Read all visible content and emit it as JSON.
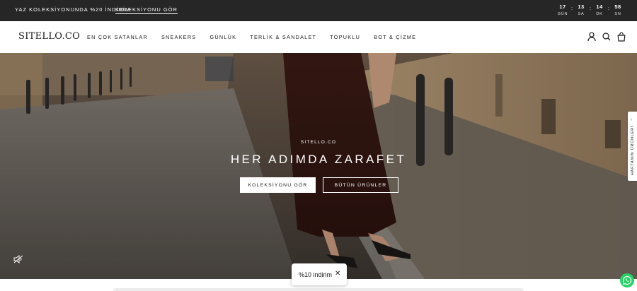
{
  "announcement": {
    "message": "YAZ KOLEKSİYONUNDA %20 İNDİRİM",
    "link_label": "KOLEKSİYONU GÖR",
    "countdown": [
      {
        "value": "17",
        "label": "GÜN"
      },
      {
        "value": "13",
        "label": "SA"
      },
      {
        "value": "14",
        "label": "DK"
      },
      {
        "value": "58",
        "label": "SN"
      }
    ],
    "separator": ":"
  },
  "header": {
    "logo": "SITELLO.CO",
    "nav": [
      "EN ÇOK SATANLAR",
      "SNEAKERS",
      "GÜNLÜK",
      "TERLİK & SANDALET",
      "TOPUKLU",
      "BOT & ÇİZME"
    ],
    "icons": [
      "account-icon",
      "search-icon",
      "cart-icon"
    ]
  },
  "hero": {
    "eyebrow": "SITELLO.CO",
    "headline": "HER ADIMDA ZARAFET",
    "primary_button": "KOLEKSİYONU GÖR",
    "secondary_button": "BÜTÜN ÜRÜNLER"
  },
  "side_tab": {
    "label": "HAFTANIN ÜRÜNLERİ",
    "chevron": "‹"
  },
  "discount_popup": {
    "label": "%10 indirim",
    "close": "✕"
  },
  "colors": {
    "announce_bg": "#262626",
    "whatsapp": "#25d366"
  }
}
